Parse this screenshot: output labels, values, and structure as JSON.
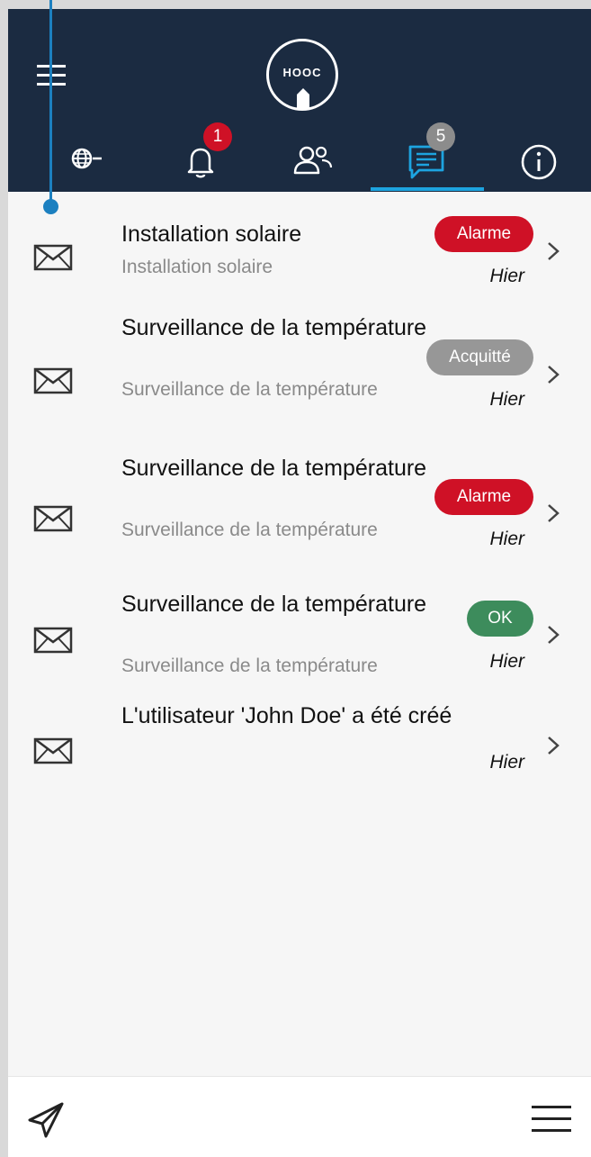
{
  "header": {
    "logo_text": "HOOC",
    "tabs": [
      {
        "name": "network",
        "icon": "globe-icon"
      },
      {
        "name": "alerts",
        "icon": "bell-icon",
        "badge": "1"
      },
      {
        "name": "users",
        "icon": "users-icon"
      },
      {
        "name": "messages",
        "icon": "message-icon",
        "badge": "5",
        "active": true
      },
      {
        "name": "info",
        "icon": "info-icon"
      }
    ]
  },
  "messages": [
    {
      "title": "Installation solaire",
      "subtitle": "Installation solaire",
      "status": "Alarme",
      "status_color": "#cf1126",
      "date": "Hier"
    },
    {
      "title": "Surveillance de la température",
      "subtitle": "Surveillance de la température",
      "status": "Acquitté",
      "status_color": "#979797",
      "date": "Hier"
    },
    {
      "title": "Surveillance de la température",
      "subtitle": "Surveillance de la température",
      "status": "Alarme",
      "status_color": "#cf1126",
      "date": "Hier"
    },
    {
      "title": "Surveillance de la température",
      "subtitle": "Surveillance de la température",
      "status": "OK",
      "status_color": "#3d8c5c",
      "date": "Hier"
    },
    {
      "title": "L'utilisateur 'John Doe' a été créé",
      "subtitle": "",
      "status": "",
      "date": "Hier"
    }
  ],
  "colors": {
    "header_bg": "#1b2b41",
    "accent": "#1da4e0",
    "alarm": "#cf1126",
    "ok": "#3d8c5c",
    "acknowledged": "#979797"
  }
}
